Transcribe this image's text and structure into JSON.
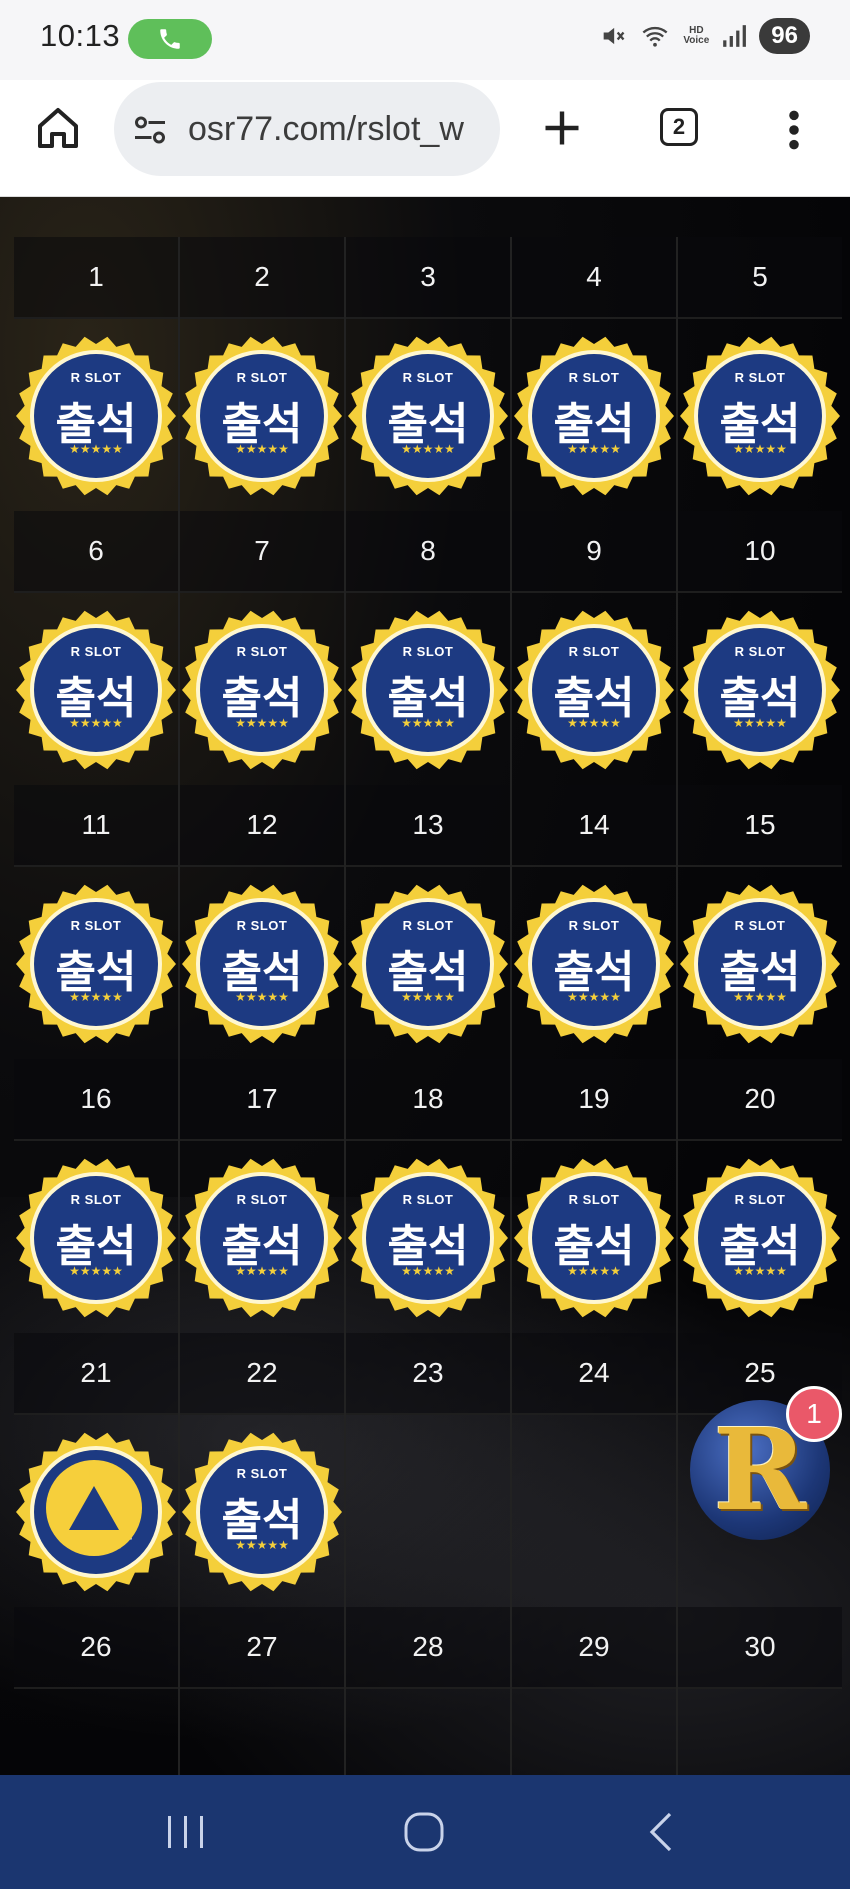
{
  "status_bar": {
    "time": "10:13",
    "battery": "96",
    "icons": [
      "phone-call-icon",
      "mute-icon",
      "wifi-icon",
      "hd-voice-icon",
      "signal-icon"
    ],
    "hd_label_top": "HD",
    "hd_label_bottom": "Voice",
    "call_color": "#5fbf5a"
  },
  "browser": {
    "url": "osr77.com/rslot_w",
    "tab_count": "2",
    "icons": [
      "home-icon",
      "site-settings-icon",
      "plus-icon",
      "tab-switcher-icon",
      "more-vert-icon"
    ]
  },
  "calendar": {
    "days": [
      {
        "day": "1",
        "stamped": true
      },
      {
        "day": "2",
        "stamped": true
      },
      {
        "day": "3",
        "stamped": true
      },
      {
        "day": "4",
        "stamped": true
      },
      {
        "day": "5",
        "stamped": true
      },
      {
        "day": "6",
        "stamped": true
      },
      {
        "day": "7",
        "stamped": true
      },
      {
        "day": "8",
        "stamped": true
      },
      {
        "day": "9",
        "stamped": true
      },
      {
        "day": "10",
        "stamped": true
      },
      {
        "day": "11",
        "stamped": true
      },
      {
        "day": "12",
        "stamped": true
      },
      {
        "day": "13",
        "stamped": true
      },
      {
        "day": "14",
        "stamped": true
      },
      {
        "day": "15",
        "stamped": true
      },
      {
        "day": "16",
        "stamped": true
      },
      {
        "day": "17",
        "stamped": true
      },
      {
        "day": "18",
        "stamped": true
      },
      {
        "day": "19",
        "stamped": true
      },
      {
        "day": "20",
        "stamped": true
      },
      {
        "day": "21",
        "stamped": true
      },
      {
        "day": "22",
        "stamped": true
      },
      {
        "day": "23",
        "stamped": false
      },
      {
        "day": "24",
        "stamped": false
      },
      {
        "day": "25",
        "stamped": false
      },
      {
        "day": "26",
        "stamped": false
      },
      {
        "day": "27",
        "stamped": false
      },
      {
        "day": "28",
        "stamped": false
      },
      {
        "day": "29",
        "stamped": false
      },
      {
        "day": "30",
        "stamped": false
      }
    ],
    "stamp": {
      "brand": "R SLOT",
      "label": "출석",
      "stars": "★★★★★",
      "ring_color": "#f4cf3b",
      "fill_color": "#1d3a82"
    }
  },
  "floating": {
    "scroll_top_icon": "triangle-up-icon",
    "fab_letter": "R",
    "notification_count": "1",
    "accent": "#f6cf3b"
  },
  "nav_bar": {
    "icons": [
      "recent-apps-icon",
      "home-circle-icon",
      "back-icon"
    ],
    "color": "#1b3670"
  }
}
